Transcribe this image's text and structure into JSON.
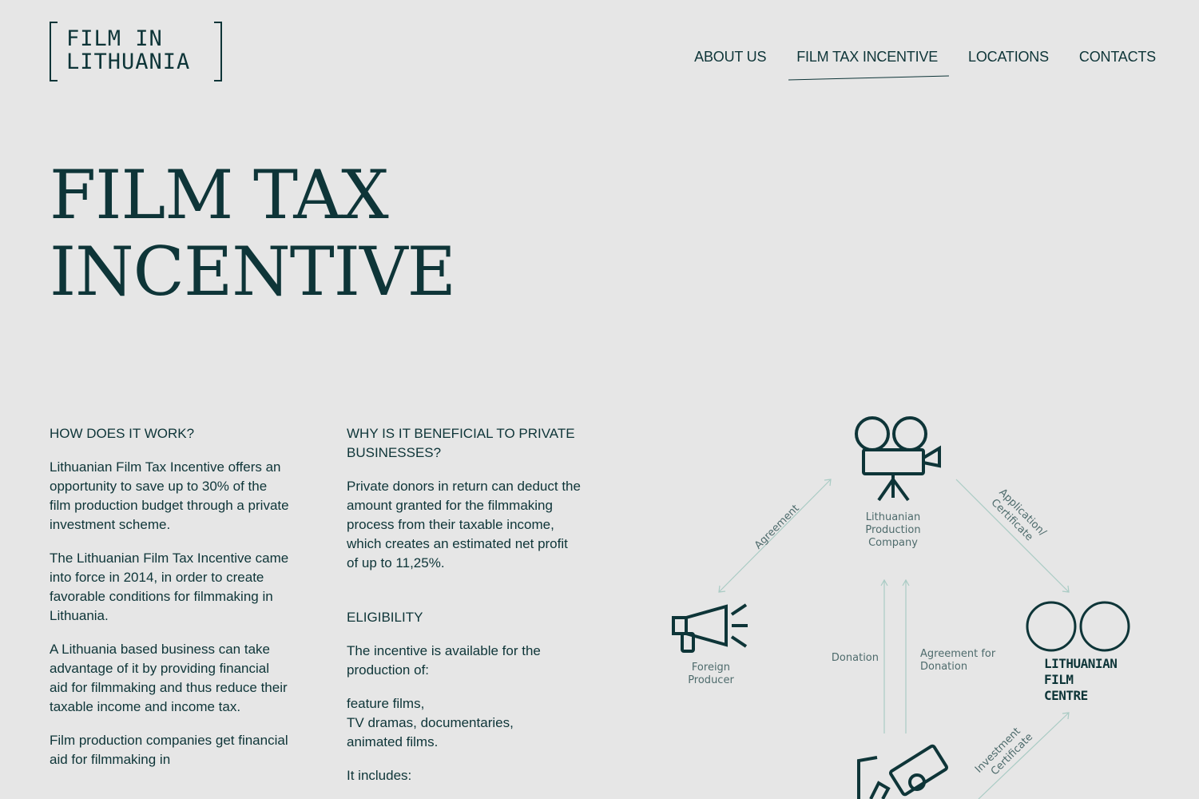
{
  "header": {
    "logo_line1": "FILM IN",
    "logo_line2": "LITHUANIA",
    "nav": [
      {
        "label": "ABOUT US"
      },
      {
        "label": "FILM TAX INCENTIVE",
        "active": true
      },
      {
        "label": "LOCATIONS"
      },
      {
        "label": "CONTACTS"
      }
    ]
  },
  "hero": {
    "title_line1": "FILM TAX",
    "title_line2": "INCENTIVE"
  },
  "col1": {
    "heading": "HOW DOES IT WORK?",
    "p1": "Lithuanian Film Tax Incentive offers an opportunity to save up to 30% of the film production budget through a private investment scheme.",
    "p2": "The Lithuanian Film Tax Incentive came into force in 2014, in order to create favorable conditions for filmmaking in Lithuania.",
    "p3": "A Lithuania based business can take advantage of it by providing financial aid for filmmaking and thus reduce their taxable income and income tax.",
    "p4": "Film production companies get financial aid for filmmaking in"
  },
  "col2": {
    "heading": "WHY IS IT BENEFICIAL TO PRIVATE BUSINESSES?",
    "p1": "Private donors in return can deduct the amount granted for the filmmaking process from their taxable income, which creates an estimated net profit of up to 11,25%.",
    "eligibility_heading": "ELIGIBILITY",
    "p2": "The incentive is available for the production of:",
    "list_line1": "feature films,",
    "list_line2": "TV dramas, documentaries,",
    "list_line3": "animated films.",
    "p3": "It includes:"
  },
  "diagram": {
    "production_company": "Lithuanian Production Company",
    "foreign_producer": "Foreign Producer",
    "lfc_line1": "LITHUANIAN",
    "lfc_line2": "FILM",
    "lfc_line3": "CENTRE",
    "agreement": "Agreement",
    "application_line1": "Application/",
    "application_line2": "Certificate",
    "donation": "Donation",
    "agreement_for_donation": "Agreement for Donation",
    "investment_line1": "Investment",
    "investment_line2": "Certificate",
    "colors": {
      "primary": "#0e3538",
      "arrow": "#a9cbc4",
      "label": "#4e6b6c"
    }
  }
}
